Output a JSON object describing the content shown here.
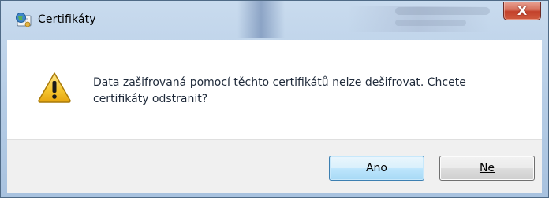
{
  "window": {
    "title": "Certifikáty",
    "close_glyph": "X"
  },
  "dialog": {
    "icon": "warning-icon",
    "message": "Data zašifrovaná pomocí těchto certifikátů nelze dešifrovat. Chcete certifikáty odstranit?"
  },
  "buttons": {
    "yes_label": "Ano",
    "no_label": "Ne"
  },
  "colors": {
    "accent_button_border": "#3c7fb1",
    "close_button": "#c3412b",
    "warning_fill": "#f2c230"
  }
}
